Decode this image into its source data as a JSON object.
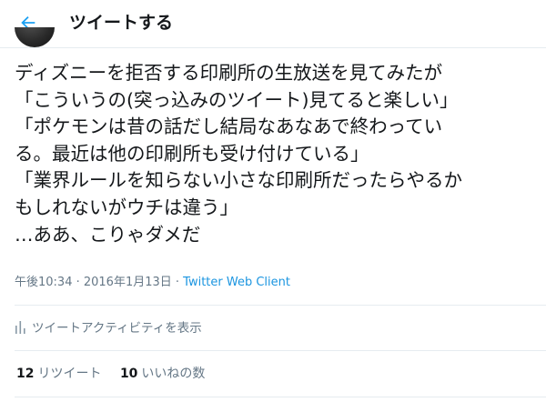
{
  "header": {
    "title": "ツイートする",
    "back_icon": "arrow-left-icon",
    "accent_color": "#1da1f2"
  },
  "tweet": {
    "lines": [
      "ディズニーを拒否する印刷所の生放送を見てみたが",
      "「こういうの(突っ込みのツイート)見てると楽しい」",
      "「ポケモンは昔の話だし結局なあなあで終わってい",
      "る。最近は他の印刷所も受け付けている」",
      "「業界ルールを知らない小さな印刷所だったらやるか",
      "もしれないがウチは違う」",
      "…ああ、こりゃダメだ"
    ],
    "timestamp": "午後10:34 · 2016年1月13日",
    "separator": " · ",
    "client": "Twitter Web Client"
  },
  "activity": {
    "label": "ツイートアクティビティを表示",
    "icon": "bar-chart-icon"
  },
  "stats": {
    "retweets_count": "12",
    "retweets_label": "リツイート",
    "likes_count": "10",
    "likes_label": "いいねの数"
  }
}
